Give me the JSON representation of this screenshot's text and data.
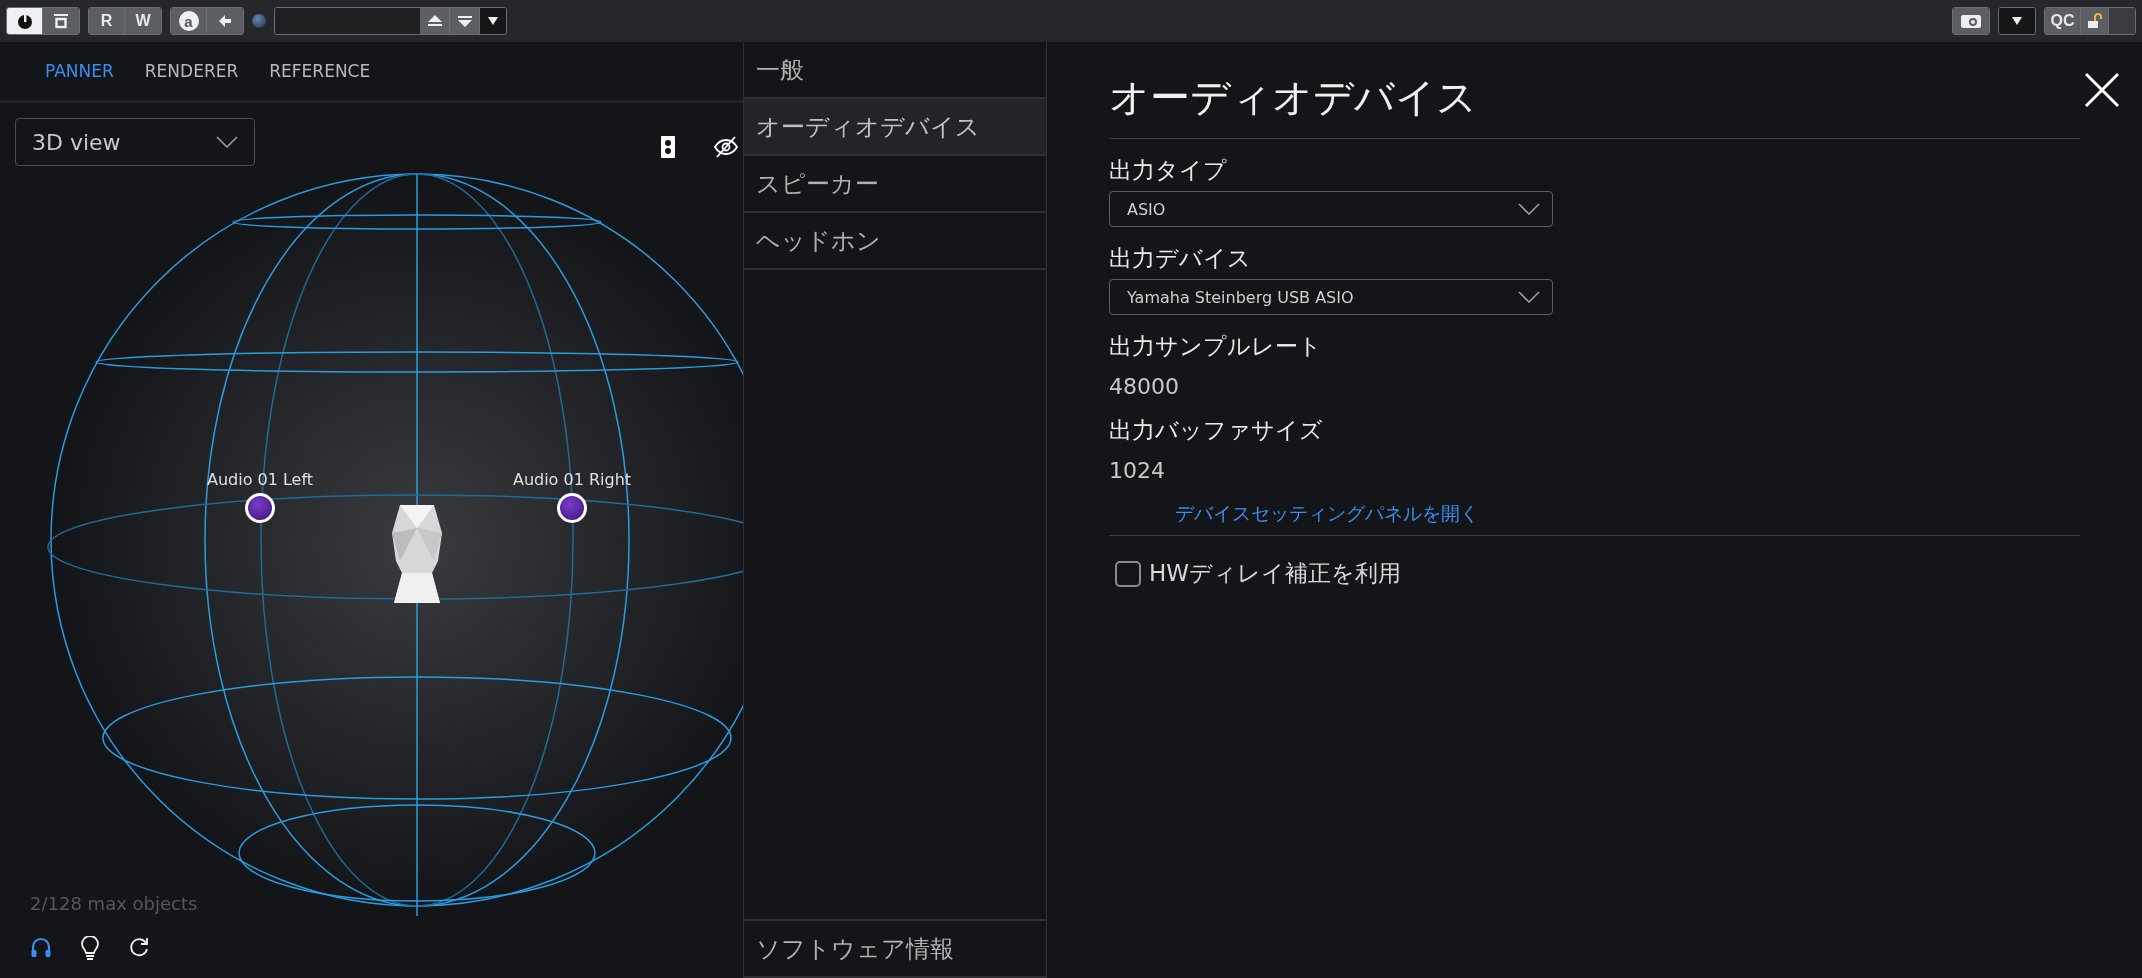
{
  "toolbar": {
    "rw_buttons": [
      {
        "label": "R"
      },
      {
        "label": "W"
      }
    ],
    "automation_label": "a",
    "qc_label": "QC"
  },
  "panner": {
    "tabs": [
      {
        "label": "PANNER",
        "selected": true
      },
      {
        "label": "RENDERER",
        "selected": false
      },
      {
        "label": "REFERENCE",
        "selected": false
      }
    ],
    "view_select": {
      "value": "3D view"
    },
    "objects": [
      {
        "label": "Audio 01 Left"
      },
      {
        "label": "Audio 01 Right"
      }
    ],
    "object_count": "2/128 max objects",
    "bottom_tools": [
      {
        "kind": "headphones",
        "active": true
      },
      {
        "kind": "bulb",
        "active": false
      },
      {
        "kind": "reset",
        "active": false
      }
    ]
  },
  "nav": {
    "items": [
      {
        "label": "一般",
        "selected": false
      },
      {
        "label": "オーディオデバイス",
        "selected": true
      },
      {
        "label": "スピーカー",
        "selected": false
      },
      {
        "label": "ヘッドホン",
        "selected": false
      }
    ],
    "footer_item": "ソフトウェア情報"
  },
  "settings": {
    "title": "オーディオデバイス",
    "fields": [
      {
        "kind": "select",
        "label": "出力タイプ",
        "value": "ASIO"
      },
      {
        "kind": "select",
        "label": "出力デバイス",
        "value": "Yamaha Steinberg USB ASIO"
      },
      {
        "kind": "readout",
        "label": "出力サンプルレート",
        "value": "48000"
      },
      {
        "kind": "readout",
        "label": "出力バッファサイズ",
        "value": "1024"
      }
    ],
    "link": "デバイスセッティングパネルを開く",
    "options": [
      {
        "label": "HWディレイ補正を利用",
        "checked": false
      }
    ]
  }
}
